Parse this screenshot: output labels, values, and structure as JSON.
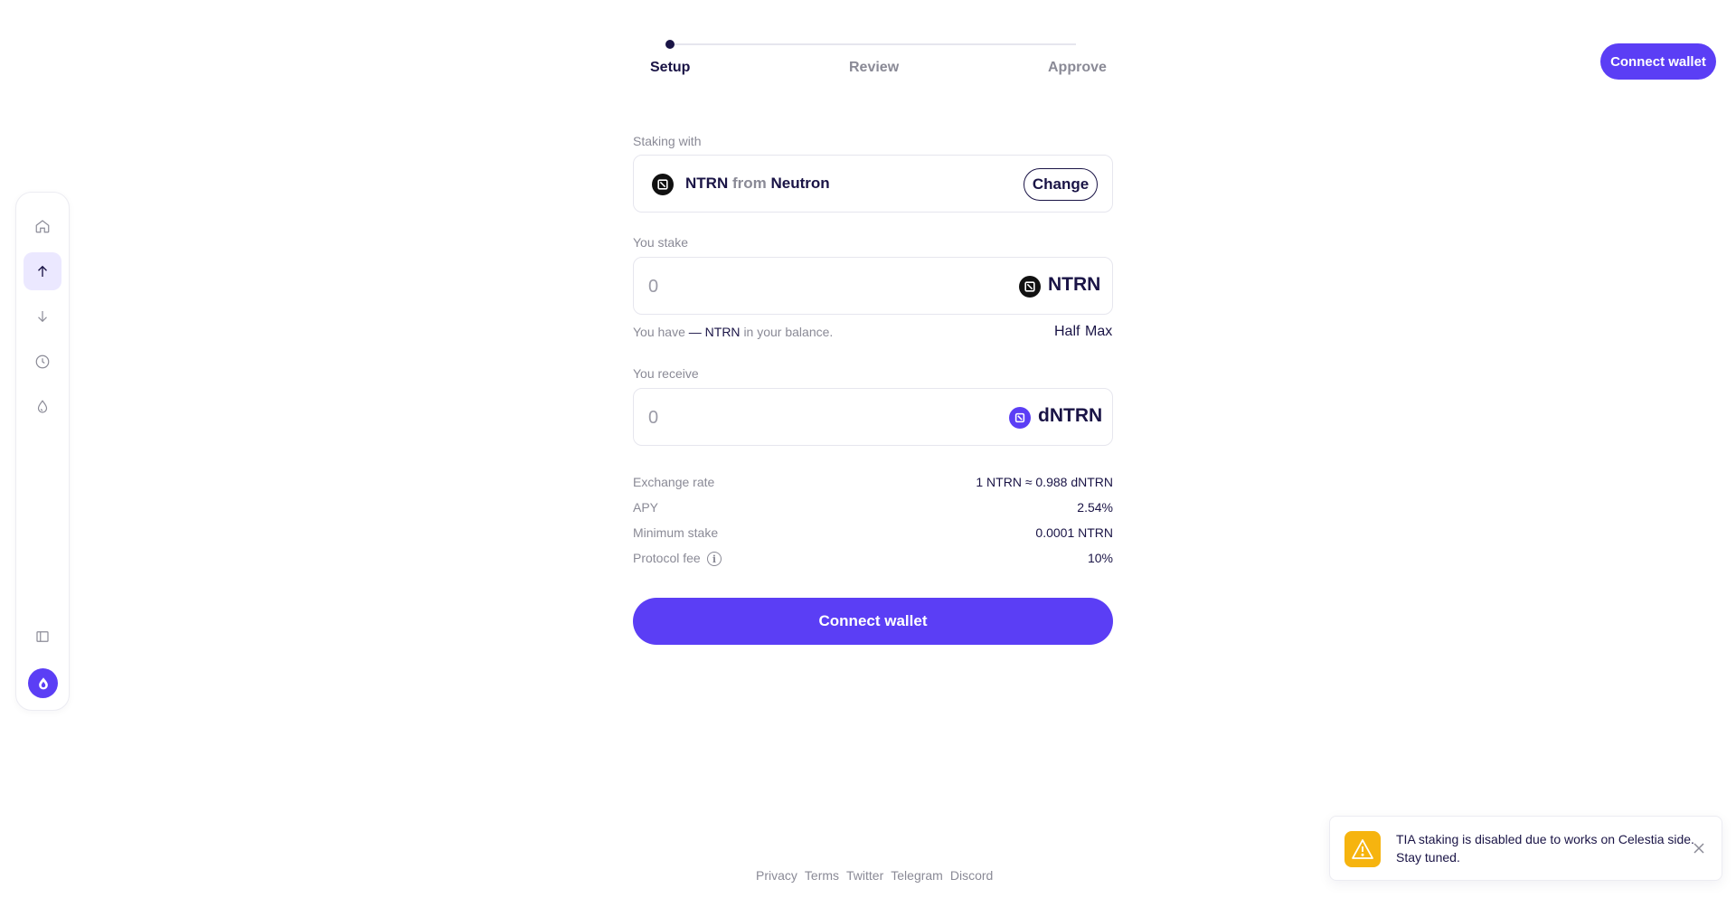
{
  "header": {
    "connect_label": "Connect wallet"
  },
  "stepper": {
    "steps": [
      {
        "label": "Setup",
        "active": true
      },
      {
        "label": "Review",
        "active": false
      },
      {
        "label": "Approve",
        "active": false
      }
    ]
  },
  "sidebar": {
    "items": [
      {
        "icon": "home-icon"
      },
      {
        "icon": "arrow-up-icon",
        "active": true
      },
      {
        "icon": "arrow-down-icon"
      },
      {
        "icon": "clock-icon"
      },
      {
        "icon": "drop-icon"
      }
    ],
    "bottom_icon": "sidebar-panel-icon",
    "logo_icon": "drop-logo-icon"
  },
  "staking_with": {
    "label": "Staking with",
    "token": "NTRN",
    "from_word": "from",
    "chain": "Neutron",
    "change_label": "Change"
  },
  "you_stake": {
    "label": "You stake",
    "placeholder": "0",
    "token": "NTRN"
  },
  "balance": {
    "prefix": "You have",
    "amount_token": "— NTRN",
    "suffix": "in your balance.",
    "half_label": "Half",
    "max_label": "Max"
  },
  "you_receive": {
    "label": "You receive",
    "placeholder": "0",
    "token": "dNTRN"
  },
  "info": {
    "exchange_rate": {
      "label": "Exchange rate",
      "value": "1 NTRN ≈ 0.988 dNTRN"
    },
    "apy": {
      "label": "APY",
      "value": "2.54%"
    },
    "minimum_stake": {
      "label": "Minimum stake",
      "value": "0.0001 NTRN"
    },
    "protocol_fee": {
      "label": "Protocol fee",
      "info_glyph": "i",
      "value": "10%"
    }
  },
  "main_button": {
    "label": "Connect wallet"
  },
  "footer": {
    "links": [
      "Privacy",
      "Terms",
      "Twitter",
      "Telegram",
      "Discord"
    ]
  },
  "toast": {
    "message": "TIA staking is disabled due to works on Celestia side. Stay tuned."
  },
  "colors": {
    "accent": "#5b3ef5",
    "text_dark": "#1a1446",
    "muted": "#8a8a96",
    "warning": "#f6b40f"
  }
}
